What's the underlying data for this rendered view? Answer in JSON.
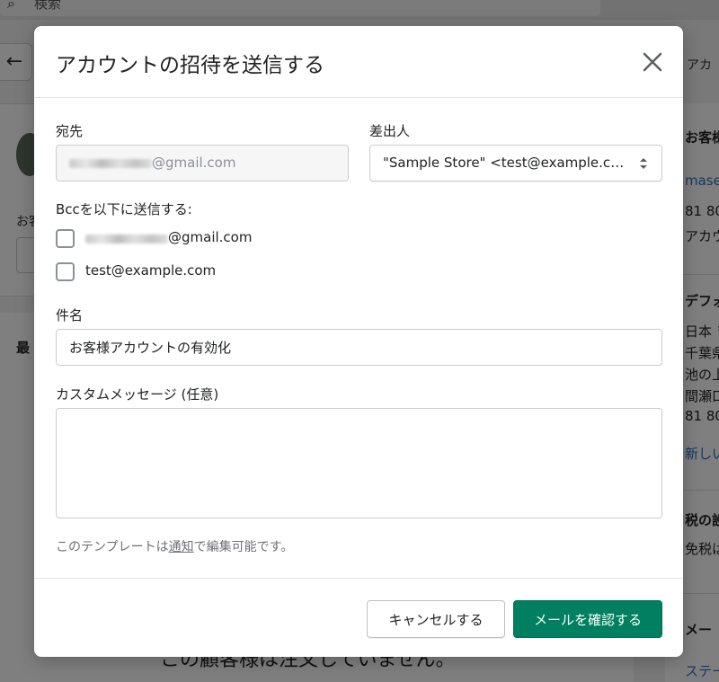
{
  "background": {
    "search_placeholder": "検索",
    "right_tab": "アカ",
    "left_label": "お客",
    "left_heading": "最",
    "bottom_text": "この顧客様は注文していません。",
    "right_fragments": [
      "お客様",
      "mase",
      "81 80",
      "アカウ",
      "デフォル",
      "日本 〒",
      "千葉県",
      "池の上",
      "間瀬口",
      "81 80",
      "新しい",
      "税の設定",
      "免税は",
      "メー",
      "ステー"
    ]
  },
  "modal": {
    "title": "アカウントの招待を送信する",
    "to": {
      "label": "宛先",
      "value_domain": "@gmail.com"
    },
    "from": {
      "label": "差出人",
      "value": "\"Sample Store\" <test@example.com>"
    },
    "bcc": {
      "label": "Bccを以下に送信する:",
      "options": [
        {
          "domain": "@gmail.com",
          "checked": false
        },
        {
          "label": "test@example.com",
          "checked": false
        }
      ]
    },
    "subject": {
      "label": "件名",
      "value": "お客様アカウントの有効化"
    },
    "message": {
      "label": "カスタムメッセージ (任意)",
      "value": ""
    },
    "help": {
      "prefix": "このテンプレートは",
      "link": "通知",
      "suffix": "で編集可能です。"
    },
    "buttons": {
      "cancel": "キャンセルする",
      "confirm": "メールを確認する"
    }
  },
  "colors": {
    "primary": "#008060",
    "border": "#c9cccf",
    "text": "#202223",
    "muted": "#6d7175"
  },
  "icons": {
    "close": "close-icon",
    "select": "select-arrows-icon"
  }
}
